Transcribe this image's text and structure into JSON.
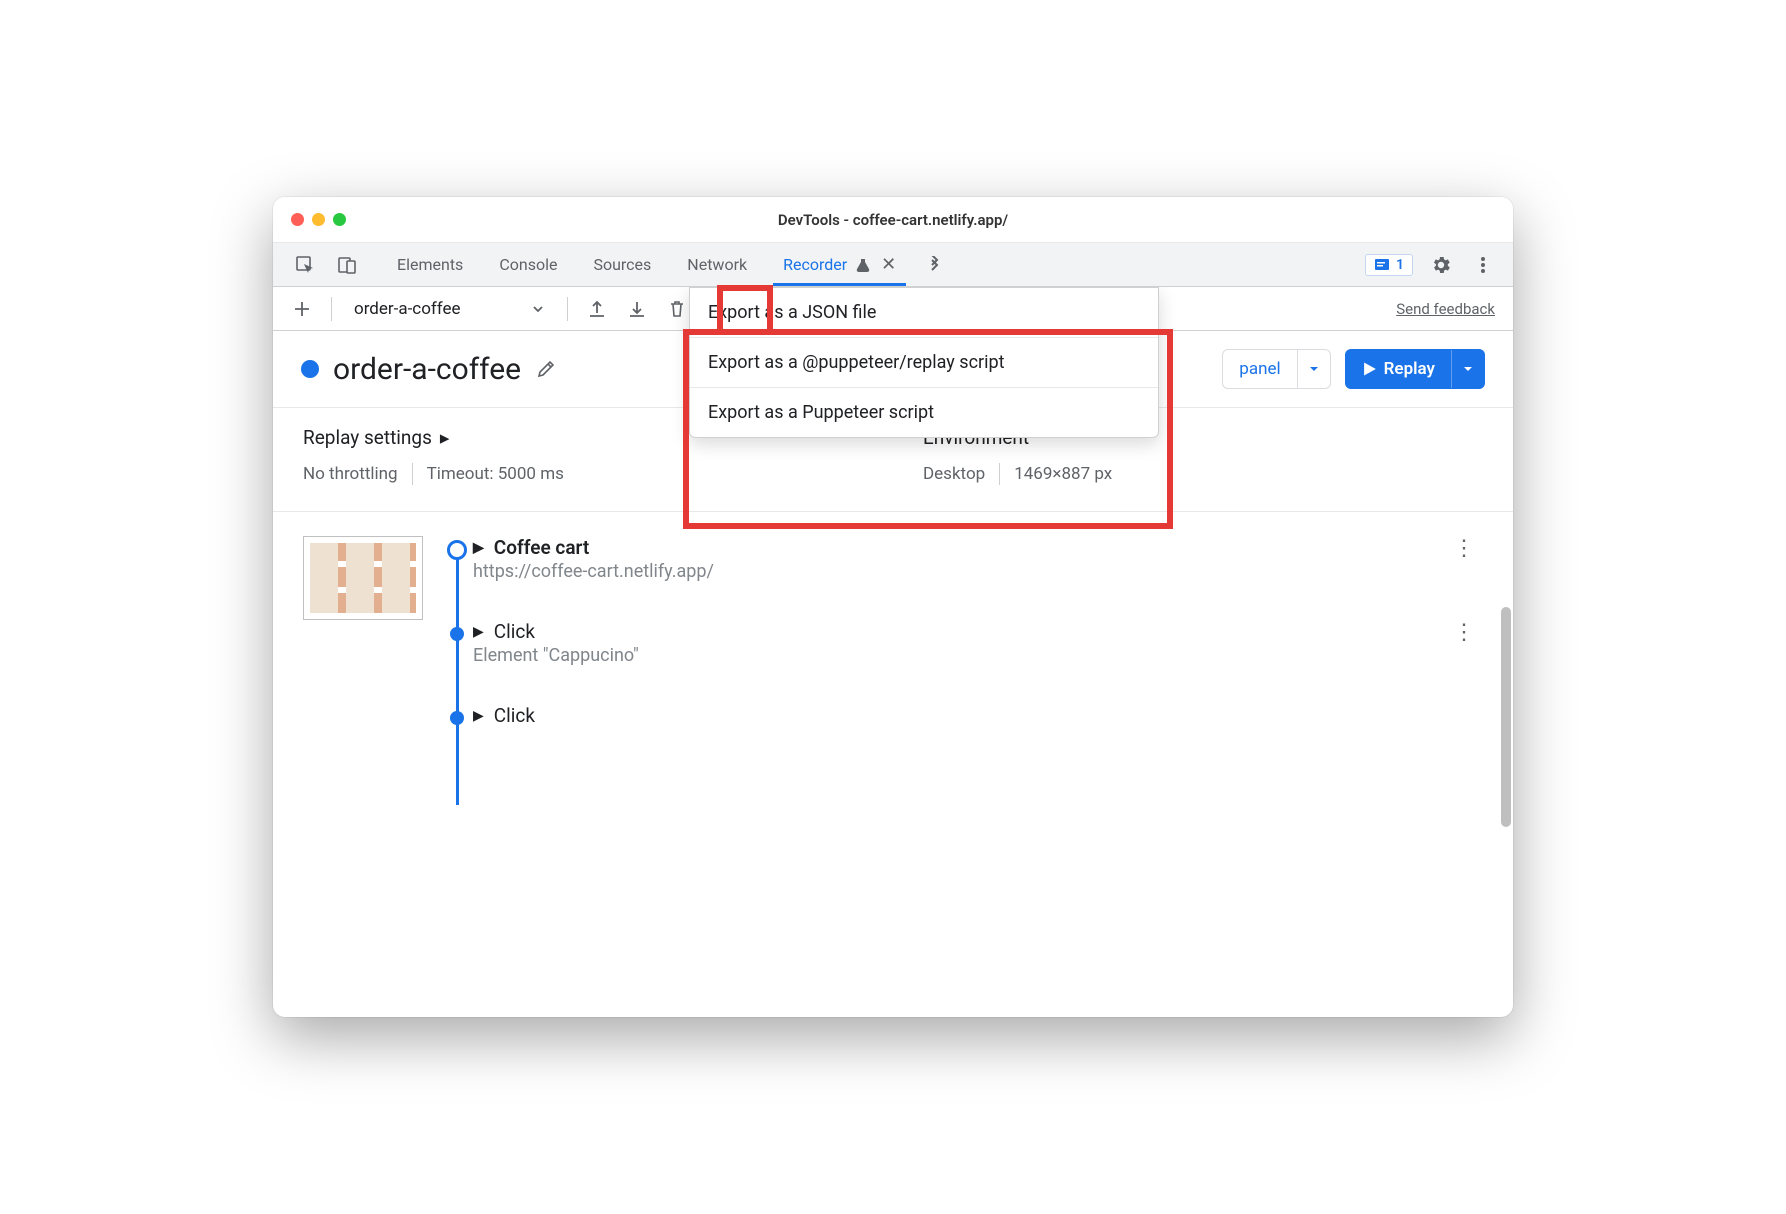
{
  "window": {
    "title": "DevTools - coffee-cart.netlify.app/"
  },
  "tabs": {
    "items": [
      "Elements",
      "Console",
      "Sources",
      "Network",
      "Recorder"
    ],
    "activeIndex": 4,
    "errorsBadge": "1"
  },
  "toolbar": {
    "recordingName": "order-a-coffee",
    "feedback": "Send feedback"
  },
  "recording": {
    "title": "order-a-coffee",
    "perfPanel": "panel",
    "replay": "Replay"
  },
  "exportMenu": {
    "items": [
      "Export as a JSON file",
      "Export as a @puppeteer/replay script",
      "Export as a Puppeteer script"
    ]
  },
  "settings": {
    "replayHeader": "Replay settings",
    "throttling": "No throttling",
    "timeout": "Timeout: 5000 ms",
    "envHeader": "Environment",
    "device": "Desktop",
    "viewport": "1469×887 px"
  },
  "steps": [
    {
      "title": "Coffee cart",
      "sub": "https://coffee-cart.netlify.app/",
      "bold": true,
      "node": "open"
    },
    {
      "title": "Click",
      "sub": "Element \"Cappucino\"",
      "bold": false,
      "node": "filled"
    },
    {
      "title": "Click",
      "sub": "",
      "bold": false,
      "node": "filled"
    }
  ]
}
